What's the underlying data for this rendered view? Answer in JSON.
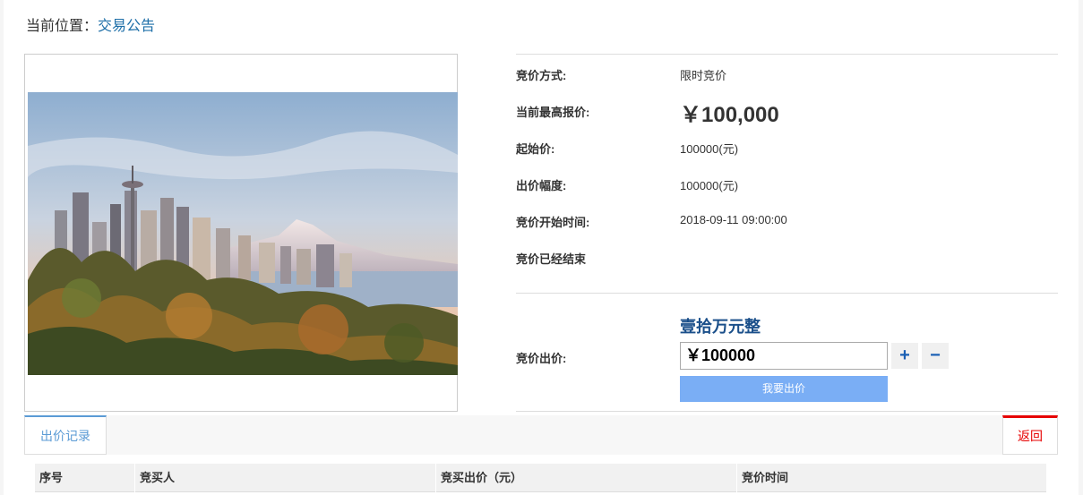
{
  "breadcrumb": {
    "prefix": "当前位置：",
    "link": "交易公告"
  },
  "auction": {
    "method_label": "竞价方式:",
    "method_value": "限时竞价",
    "highest_label": "当前最高报价:",
    "highest_value": "￥100,000",
    "start_price_label": "起始价:",
    "start_price_value": "100000(元)",
    "increment_label": "出价幅度:",
    "increment_value": "100000(元)",
    "start_time_label": "竞价开始时间:",
    "start_time_value": "2018-09-11 09:00:00",
    "status_text": "竞价已经结束"
  },
  "bid": {
    "label": "竞价出价:",
    "amount_words": "壹拾万元整",
    "amount_value": "￥100000",
    "plus_label": "+",
    "minus_label": "−",
    "submit_label": "我要出价"
  },
  "tabs": {
    "records_label": "出价记录",
    "back_label": "返回"
  },
  "table": {
    "headers": [
      "序号",
      "竞买人",
      "竞买出价（元）",
      "竞价时间"
    ]
  },
  "colors": {
    "price": "#e60000",
    "accent": "#5b9bd5",
    "submit": "#7aaef5",
    "words": "#1a4f8a"
  },
  "image": {
    "subject": "city skyline with Space Needle and snow-capped mountain at sunset"
  }
}
